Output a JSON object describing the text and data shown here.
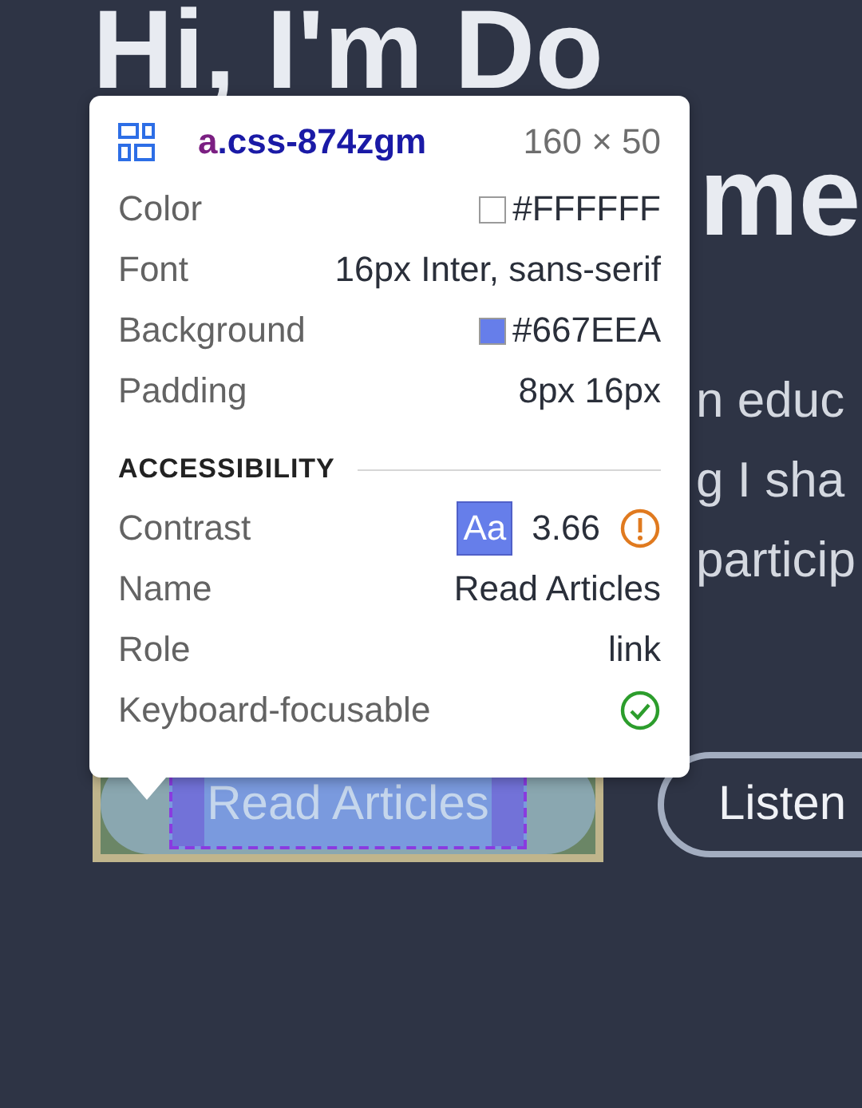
{
  "page": {
    "heading_lines": [
      "Hi, I'm Do",
      "me"
    ],
    "paragraph_lines": [
      "n educ",
      "g I sha",
      "particip"
    ],
    "buttons": [
      {
        "label": "Read Articles",
        "kind": "primary",
        "highlighted": true
      },
      {
        "label": "Listen",
        "kind": "outline",
        "highlighted": false
      }
    ]
  },
  "inspector": {
    "tag": "a",
    "class_name": ".css-874zgm",
    "size": "160 × 50",
    "properties": [
      {
        "label": "Color",
        "value": "#FFFFFF",
        "color": "#ffffff"
      },
      {
        "label": "Font",
        "value": "16px Inter, sans-serif"
      },
      {
        "label": "Background",
        "value": "#667EEA",
        "color": "#667eea"
      },
      {
        "label": "Padding",
        "value": "8px 16px"
      }
    ],
    "accessibility": {
      "title": "ACCESSIBILITY",
      "rows": [
        {
          "label": "Contrast",
          "kind": "contrast",
          "sample": "Aa",
          "value": "3.66",
          "warning": true
        },
        {
          "label": "Name",
          "kind": "text",
          "value": "Read Articles"
        },
        {
          "label": "Role",
          "kind": "text",
          "value": "link"
        },
        {
          "label": "Keyboard-focusable",
          "kind": "status",
          "focusable": true
        }
      ]
    }
  }
}
